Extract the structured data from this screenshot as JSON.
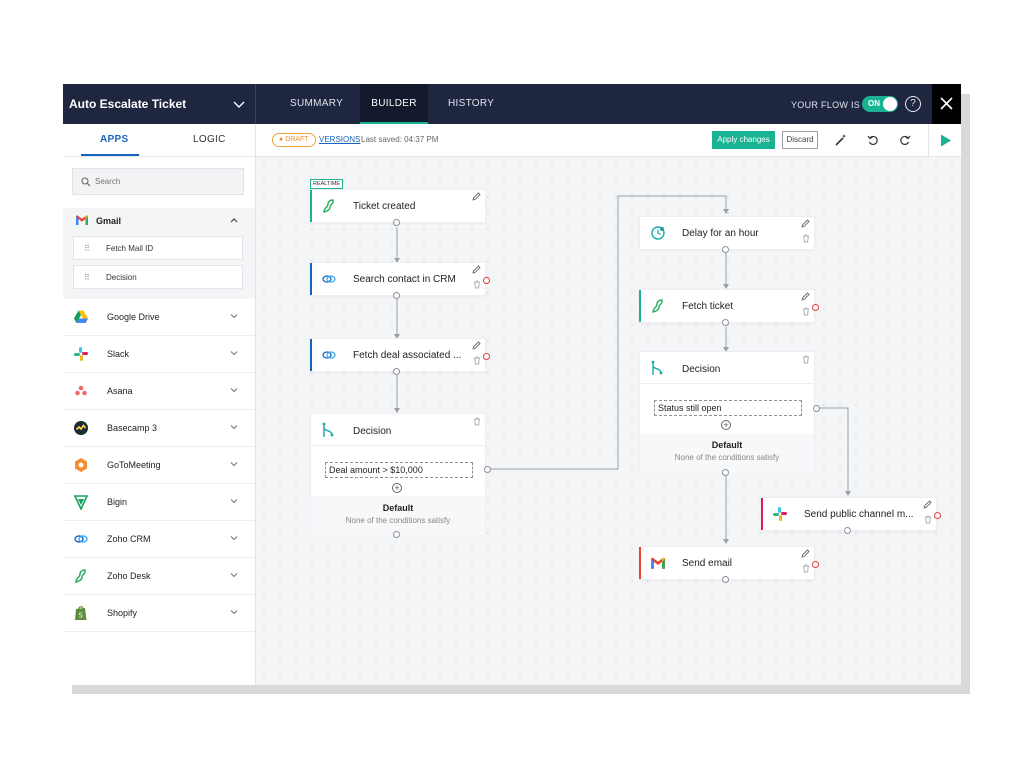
{
  "header": {
    "flow_title": "Auto Escalate Ticket",
    "tabs": [
      "SUMMARY",
      "BUILDER",
      "HISTORY"
    ],
    "active_tab": "BUILDER",
    "your_flow_label": "YOUR FLOW IS",
    "toggle_label": "ON",
    "help_icon": "?"
  },
  "sidebar": {
    "tabs": [
      "APPS",
      "LOGIC"
    ],
    "search_placeholder": "Search",
    "gmail": {
      "label": "Gmail",
      "items": [
        "Fetch Mail ID",
        "Decision"
      ]
    },
    "apps": [
      {
        "label": "Google Drive",
        "icon": "google-drive-icon"
      },
      {
        "label": "Slack",
        "icon": "slack-icon"
      },
      {
        "label": "Asana",
        "icon": "asana-icon"
      },
      {
        "label": "Basecamp 3",
        "icon": "basecamp-icon"
      },
      {
        "label": "GoToMeeting",
        "icon": "gotomeeting-icon"
      },
      {
        "label": "Bigin",
        "icon": "bigin-icon"
      },
      {
        "label": "Zoho CRM",
        "icon": "zoho-crm-icon"
      },
      {
        "label": "Zoho Desk",
        "icon": "zoho-desk-icon"
      },
      {
        "label": "Shopify",
        "icon": "shopify-icon"
      }
    ]
  },
  "toolbar": {
    "draft": "DRAFT",
    "versions": "VERSIONS",
    "last_saved": "Last saved: 04:37 PM",
    "apply": "Apply changes",
    "discard": "Discard"
  },
  "canvas": {
    "realtime": "REALTIME",
    "nodes": {
      "ticket_created": "Ticket created",
      "search_contact": "Search contact in CRM",
      "fetch_deal": "Fetch deal associated ...",
      "decision_1": "Decision",
      "delay": "Delay for an hour",
      "fetch_ticket": "Fetch ticket",
      "decision_2": "Decision",
      "send_slack": "Send public channel m...",
      "send_email": "Send email"
    },
    "decision_1": {
      "condition": "Deal amount > $10,000",
      "default_title": "Default",
      "default_sub": "None of the conditions satisfy"
    },
    "decision_2": {
      "condition": "Status still open",
      "default_title": "Default",
      "default_sub": "None of the conditions satisfy"
    }
  },
  "colors": {
    "topbar": "#1f2740",
    "accent_green": "#19b394",
    "link_blue": "#1565c0",
    "draft_orange": "#e8962c",
    "slack_red": "#e01e5a",
    "gmail_red": "#ea4335",
    "crm_blue": "#1565c0"
  }
}
